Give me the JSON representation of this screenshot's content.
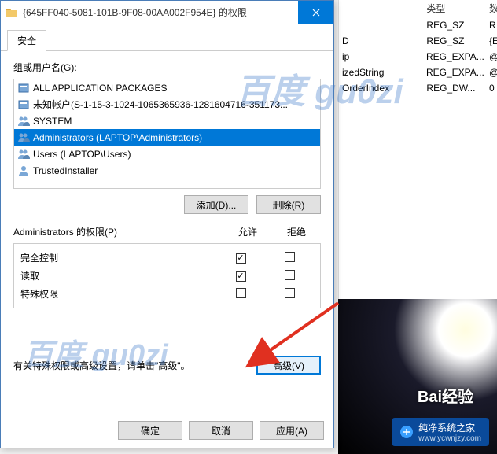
{
  "window": {
    "title": "{645FF040-5081-101B-9F08-00AA002F954E} 的权限",
    "close": "×"
  },
  "tab": {
    "security": "安全"
  },
  "groups_label": "组或用户名(G):",
  "users": [
    {
      "name": "ALL APPLICATION PACKAGES",
      "type": "pkg"
    },
    {
      "name": "未知帐户(S-1-15-3-1024-1065365936-1281604716-351173...",
      "type": "pkg"
    },
    {
      "name": "SYSTEM",
      "type": "grp"
    },
    {
      "name": "Administrators (LAPTOP\\Administrators)",
      "type": "grp",
      "selected": true
    },
    {
      "name": "Users (LAPTOP\\Users)",
      "type": "grp"
    },
    {
      "name": "TrustedInstaller",
      "type": "usr"
    }
  ],
  "buttons": {
    "add": "添加(D)...",
    "remove": "删除(R)",
    "advanced": "高级(V)",
    "ok": "确定",
    "cancel": "取消",
    "apply": "应用(A)"
  },
  "perm_header": {
    "label": "Administrators 的权限(P)",
    "allow": "允许",
    "deny": "拒绝"
  },
  "permissions": [
    {
      "name": "完全控制",
      "allow": true,
      "deny": false
    },
    {
      "name": "读取",
      "allow": true,
      "deny": false
    },
    {
      "name": "特殊权限",
      "allow": false,
      "deny": false
    }
  ],
  "adv_text": "有关特殊权限或高级设置，请单击\"高级\"。",
  "bg": {
    "head_type": "类型",
    "head_data": "数",
    "rows": [
      {
        "name": "",
        "type": "REG_SZ",
        "data": "R"
      },
      {
        "name": "D",
        "type": "REG_SZ",
        "data": "{E"
      },
      {
        "name": "ip",
        "type": "REG_EXPA...",
        "data": "@"
      },
      {
        "name": "izedString",
        "type": "REG_EXPA...",
        "data": "@"
      },
      {
        "name": "OrderIndex",
        "type": "REG_DW...",
        "data": "0"
      }
    ]
  },
  "watermark1": "百度 gu0zi",
  "watermark2": "百度  gu0zi",
  "logo_baidu": "Bai经验",
  "logo_site": "纯净系统之家",
  "logo_url": "www.ycwnjzy.com"
}
